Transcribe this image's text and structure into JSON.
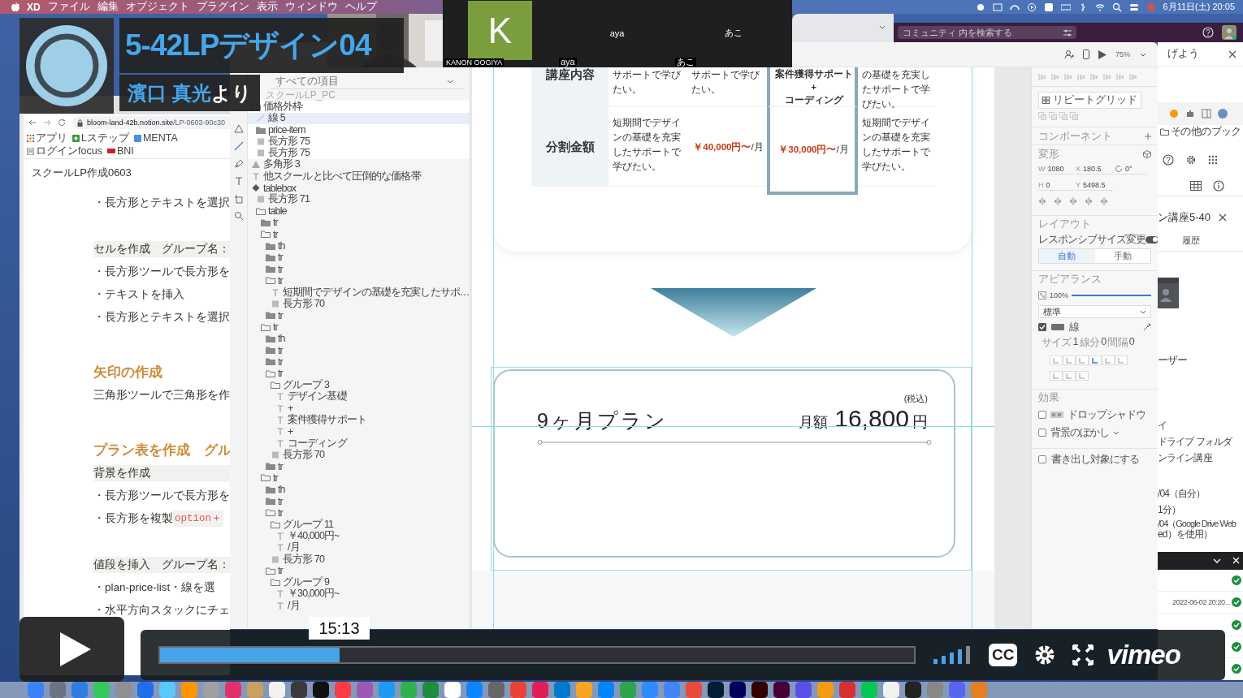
{
  "menubar": {
    "app": "XD",
    "items": [
      "ファイル",
      "編集",
      "オブジェクト",
      "プラグイン",
      "表示",
      "ウィンドウ",
      "ヘルプ"
    ],
    "clock": "6月11日(土) 20:05"
  },
  "participants": [
    {
      "kind": "avatar",
      "initial": "K",
      "name": "KANON OOGIYA"
    },
    {
      "kind": "plain",
      "display": "aya",
      "name": "aya"
    },
    {
      "kind": "plain",
      "display": "あこ",
      "name": "あこ"
    }
  ],
  "community_search": {
    "placeholder": "コミュニティ 内を検索する"
  },
  "notion": {
    "url_host": "bloom-land-42b.notion.site",
    "url_path": "/LP-0603-90c30",
    "bookmarks": [
      {
        "kind": "apps",
        "label": "アプリ"
      },
      {
        "kind": "gear",
        "label": "Lステップ"
      },
      {
        "kind": "square",
        "label": "MENTA"
      },
      {
        "kind": "doc",
        "label": "ログインfocus"
      },
      {
        "kind": "badge",
        "label": "BNI"
      }
    ],
    "page_title": "スクールLP作成0603",
    "blocks": [
      {
        "kind": "text",
        "text": "・長方形とテキストを選択"
      },
      {
        "kind": "callout",
        "text": "セルを作成　グループ名："
      },
      {
        "kind": "text",
        "text": "・長方形ツールで長方形を"
      },
      {
        "kind": "text",
        "text": "・テキストを挿入"
      },
      {
        "kind": "text",
        "text": "・長方形とテキストを選択"
      },
      {
        "kind": "heading",
        "text": "矢印の作成"
      },
      {
        "kind": "text",
        "text": "三角形ツールで三角形を作"
      },
      {
        "kind": "heading",
        "text": "プラン表を作成　グル"
      },
      {
        "kind": "callout",
        "text": "背景を作成"
      },
      {
        "kind": "text",
        "text": "・長方形ツールで長方形を"
      },
      {
        "kind": "text",
        "text": "・長方形を複製",
        "code": "option＋"
      },
      {
        "kind": "callout",
        "text": "値段を挿入　グループ名："
      },
      {
        "kind": "text",
        "text": "・plan-price-list・線を選"
      },
      {
        "kind": "text",
        "text": "・水平方向スタックにチェ"
      }
    ]
  },
  "layers": {
    "filter": "すべての項目",
    "artboard": "スクールLP_PC",
    "items": [
      {
        "label": "価格外枠",
        "kind": "group",
        "expanded": true,
        "selected": false,
        "children": [
          {
            "label": "線 5",
            "kind": "line",
            "selected": true
          },
          {
            "label": "price-item",
            "kind": "group",
            "expanded": false,
            "selected": false
          },
          {
            "label": "長方形 75",
            "kind": "rect",
            "selected": false
          },
          {
            "label": "長方形 75",
            "kind": "rect",
            "selected": false
          }
        ]
      },
      {
        "label": "多角形 3",
        "kind": "polygon",
        "selected": false
      },
      {
        "label": "他スクールと比べて圧倒的な価格帯",
        "kind": "text",
        "selected": false
      },
      {
        "label": "tablebox",
        "kind": "component",
        "expanded": true,
        "selected": false,
        "children": [
          {
            "label": "長方形 71",
            "kind": "rect",
            "selected": false
          },
          {
            "label": "table",
            "kind": "group",
            "expanded": true,
            "selected": false,
            "children": [
              {
                "label": "tr",
                "kind": "group",
                "expanded": false,
                "selected": false
              },
              {
                "label": "tr",
                "kind": "group",
                "expanded": true,
                "selected": false,
                "children": [
                  {
                    "label": "th",
                    "kind": "group",
                    "expanded": false,
                    "selected": false
                  },
                  {
                    "label": "tr",
                    "kind": "group",
                    "expanded": false,
                    "selected": false
                  },
                  {
                    "label": "tr",
                    "kind": "group",
                    "expanded": false,
                    "selected": false
                  },
                  {
                    "label": "tr",
                    "kind": "group",
                    "expanded": true,
                    "selected": false,
                    "children": [
                      {
                        "label": "短期間でデザインの基礎を充実したサポ…",
                        "kind": "text",
                        "selected": false
                      },
                      {
                        "label": "長方形 70",
                        "kind": "rect",
                        "selected": false
                      }
                    ]
                  },
                  {
                    "label": "tr",
                    "kind": "group",
                    "expanded": false,
                    "selected": false
                  }
                ]
              },
              {
                "label": "tr",
                "kind": "group",
                "expanded": true,
                "selected": false,
                "children": [
                  {
                    "label": "th",
                    "kind": "group",
                    "expanded": false,
                    "selected": false
                  },
                  {
                    "label": "tr",
                    "kind": "group",
                    "expanded": false,
                    "selected": false
                  },
                  {
                    "label": "tr",
                    "kind": "group",
                    "expanded": false,
                    "selected": false
                  },
                  {
                    "label": "tr",
                    "kind": "group",
                    "expanded": true,
                    "selected": false,
                    "children": [
                      {
                        "label": "グループ 3",
                        "kind": "group",
                        "expanded": true,
                        "selected": false,
                        "children": [
                          {
                            "label": "デザイン基礎",
                            "kind": "text",
                            "selected": false
                          },
                          {
                            "label": "+",
                            "kind": "text",
                            "selected": false
                          },
                          {
                            "label": "案件獲得サポート",
                            "kind": "text",
                            "selected": false
                          },
                          {
                            "label": "+",
                            "kind": "text",
                            "selected": false
                          },
                          {
                            "label": "コーディング",
                            "kind": "text",
                            "selected": false
                          }
                        ]
                      },
                      {
                        "label": "長方形 70",
                        "kind": "rect",
                        "selected": false
                      }
                    ]
                  },
                  {
                    "label": "tr",
                    "kind": "group",
                    "expanded": false,
                    "selected": false
                  }
                ]
              },
              {
                "label": "tr",
                "kind": "group",
                "expanded": true,
                "selected": false,
                "children": [
                  {
                    "label": "th",
                    "kind": "group",
                    "expanded": false,
                    "selected": false
                  },
                  {
                    "label": "tr",
                    "kind": "group",
                    "expanded": false,
                    "selected": false
                  },
                  {
                    "label": "tr",
                    "kind": "group",
                    "expanded": true,
                    "selected": false,
                    "children": [
                      {
                        "label": "グループ 11",
                        "kind": "group",
                        "expanded": true,
                        "selected": false,
                        "children": [
                          {
                            "label": "￥40,000円~",
                            "kind": "text",
                            "selected": false
                          },
                          {
                            "label": "/月",
                            "kind": "text",
                            "selected": false
                          }
                        ]
                      },
                      {
                        "label": "長方形 70",
                        "kind": "rect",
                        "selected": false
                      }
                    ]
                  },
                  {
                    "label": "tr",
                    "kind": "group",
                    "expanded": true,
                    "selected": false,
                    "children": [
                      {
                        "label": "グループ 9",
                        "kind": "group",
                        "expanded": true,
                        "selected": false,
                        "children": [
                          {
                            "label": "￥30,000円~",
                            "kind": "text",
                            "selected": false
                          },
                          {
                            "label": "/月",
                            "kind": "text",
                            "selected": false
                          }
                        ]
                      }
                    ]
                  }
                ]
              }
            ]
          }
        ]
      }
    ]
  },
  "table": {
    "rows": [
      {
        "header": "講座内容",
        "cells": [
          {
            "kind": "text",
            "text": "サポートで学びたい。",
            "recommended": false
          },
          {
            "kind": "text",
            "text": "サポートで学びたい。",
            "recommended": false
          },
          {
            "kind": "lines",
            "lines": [
              "案件獲得サポート",
              "+",
              "コーディング"
            ],
            "recommended": true
          },
          {
            "kind": "text",
            "text": "の基礎を充実したサポートで学びたい。",
            "recommended": false
          }
        ]
      },
      {
        "header": "分割金額",
        "cells": [
          {
            "kind": "text",
            "text": "短期間でデザインの基礎を充実したサポートで学びたい。",
            "recommended": false
          },
          {
            "kind": "price",
            "price": "￥40,000円〜",
            "unit": "/月",
            "recommended": false
          },
          {
            "kind": "price",
            "price": "￥30,000円〜",
            "unit": "/月",
            "recommended": true
          },
          {
            "kind": "text",
            "text": "短期間でデザインの基礎を充実したサポートで学びたい。",
            "recommended": false
          }
        ]
      }
    ]
  },
  "plan": {
    "name": "9ヶ月プラン",
    "tax_note": "(税込)",
    "monthly_label": "月額",
    "amount": "16,800",
    "currency": "円",
    "selected": true
  },
  "properties": {
    "zoom": "75%",
    "repeat_grid": "リピートグリッド",
    "component_header": "コンポーネント",
    "transform_header": "変形",
    "fields": [
      {
        "label": "W",
        "value": "1080"
      },
      {
        "label": "X",
        "value": "180.5"
      },
      {
        "label": "H",
        "value": "0"
      },
      {
        "label": "Y",
        "value": "5498.5"
      }
    ],
    "rotation": "0°",
    "layout_header": "レイアウト",
    "responsive": {
      "label": "レスポンシブサイズ変更",
      "on": true
    },
    "modes": [
      {
        "label": "自動",
        "selected": true
      },
      {
        "label": "手動",
        "selected": false
      }
    ],
    "appearance_header": "アピアランス",
    "opacity": {
      "reading": "100%",
      "level": 1
    },
    "blend": "標準",
    "border": {
      "checked": true,
      "label": "線",
      "size_label": "サイズ",
      "size": "1",
      "dash_label": "線分",
      "dash": "0",
      "gap_label": "間隔",
      "gap": "0"
    },
    "effects_header": "効果",
    "effects": [
      {
        "kind": "shadow",
        "label": "ドロップシャドウ",
        "checked": false
      },
      {
        "kind": "blur",
        "label": "背景のぼかし",
        "checked": false
      }
    ],
    "export": {
      "label": "書き出し対象にする",
      "checked": false
    }
  },
  "drive": {
    "popup": "げよう",
    "bookmarks_more": "その他のブック",
    "doc_title": "ン講座5-40",
    "tab": "履歴",
    "lines": [
      "ーザー",
      "イ",
      "ドライブ フォルダ",
      "ンライン講座",
      "/04（自分）",
      "1分）",
      "/04（Google Drive Web",
      "ed）を使用）"
    ],
    "uploads": [
      {
        "done": true
      },
      {
        "text": "2022-06-02 20:20...",
        "done": true
      },
      {
        "done": true
      },
      {
        "done": true
      },
      {
        "done": true
      }
    ]
  },
  "video": {
    "title": "5-42LPデザイン04",
    "author": "濱口 真光",
    "author_suffix": "より",
    "time": "15:13",
    "progress": {
      "level": 0.238
    },
    "cc": "CC",
    "brand": "vimeo"
  },
  "dock": {
    "items": [
      {
        "color": "#3b82f6"
      },
      {
        "color": "#6b7280"
      },
      {
        "color": "#2f7de1"
      },
      {
        "color": "#34c759"
      },
      {
        "color": "#8e8e93"
      },
      {
        "color": "#1f6feb"
      },
      {
        "color": "#5ac8fa"
      },
      {
        "color": "#ff9500"
      },
      {
        "color": "#a0a0a0"
      },
      {
        "color": "#e1306c"
      },
      {
        "color": "#c8a060"
      },
      {
        "color": "#f2f2f2"
      },
      {
        "color": "#3a3a3c"
      },
      {
        "color": "#111111"
      },
      {
        "color": "#fc3c44"
      },
      {
        "color": "#9b59b6"
      },
      {
        "color": "#1d9bf0"
      },
      {
        "color": "#30b050"
      },
      {
        "color": "#1e8e3e"
      },
      {
        "color": "#ffffff"
      },
      {
        "color": "#0a84ff"
      },
      {
        "color": "#666666"
      },
      {
        "color": "#ea4335"
      },
      {
        "color": "#e01e5a"
      },
      {
        "color": "#007acc"
      },
      {
        "color": "#f5a623"
      },
      {
        "color": "#0084ff"
      },
      {
        "color": "#2ea44f"
      },
      {
        "color": "#2d8cff"
      },
      {
        "color": "#4285f4"
      },
      {
        "color": "#e94b3c"
      },
      {
        "color": "#001e36"
      },
      {
        "color": "#00005b"
      },
      {
        "color": "#330000"
      },
      {
        "color": "#470137"
      },
      {
        "color": "#5b4fe9"
      },
      {
        "color": "#f39c12"
      },
      {
        "color": "#d63031"
      },
      {
        "color": "#06c755"
      },
      {
        "color": "#f1f1f1"
      },
      {
        "color": "#222222"
      },
      {
        "color": "#888888"
      },
      {
        "color": "#5865f2"
      },
      {
        "color": "#e67e22"
      }
    ]
  }
}
